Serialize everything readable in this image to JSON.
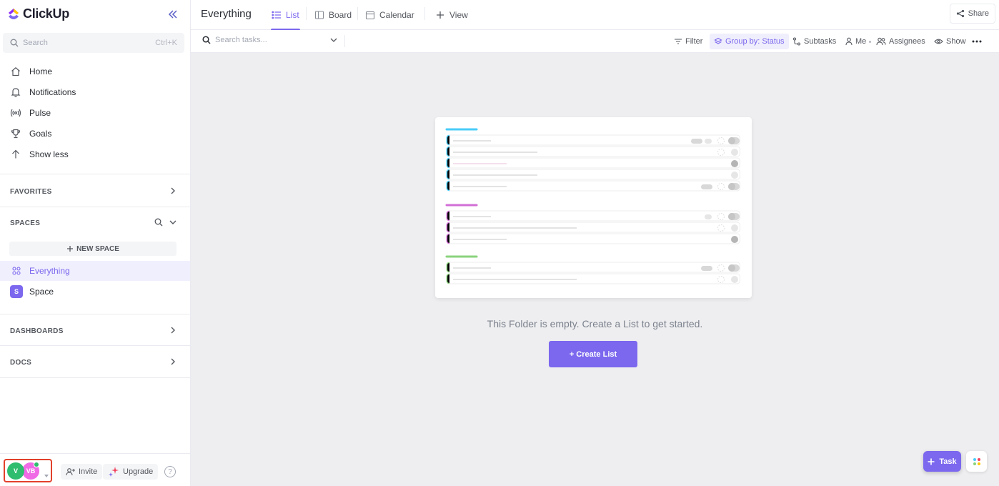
{
  "brand": {
    "name": "ClickUp"
  },
  "sidebar": {
    "search": {
      "placeholder": "Search",
      "shortcut": "Ctrl+K"
    },
    "nav": [
      {
        "label": "Home",
        "icon": "home-icon"
      },
      {
        "label": "Notifications",
        "icon": "bell-icon"
      },
      {
        "label": "Pulse",
        "icon": "pulse-icon"
      },
      {
        "label": "Goals",
        "icon": "trophy-icon"
      },
      {
        "label": "Show less",
        "icon": "arrow-up-icon"
      }
    ],
    "favorites_label": "FAVORITES",
    "spaces_label": "SPACES",
    "new_space_label": "NEW SPACE",
    "spaces": [
      {
        "label": "Everything",
        "active": true
      },
      {
        "label": "Space",
        "badge": "S"
      }
    ],
    "dashboards_label": "DASHBOARDS",
    "docs_label": "DOCS",
    "footer": {
      "avatar_1": "V",
      "avatar_2": "VB",
      "invite_label": "Invite",
      "upgrade_label": "Upgrade",
      "help_label": "?"
    }
  },
  "header": {
    "title": "Everything",
    "tabs": [
      {
        "label": "List",
        "active": true
      },
      {
        "label": "Board"
      },
      {
        "label": "Calendar"
      },
      {
        "label": "View"
      }
    ],
    "share_label": "Share"
  },
  "toolbar": {
    "search_placeholder": "Search tasks...",
    "filter_label": "Filter",
    "group_label": "Group by: Status",
    "subtasks_label": "Subtasks",
    "me_label": "Me",
    "assignees_label": "Assignees",
    "show_label": "Show"
  },
  "main": {
    "empty_text": "This Folder is empty. Create a List to get started.",
    "create_button": "+ Create List",
    "task_button": "Task"
  },
  "colors": {
    "accent": "#7b68ee",
    "group_blue": "#49ccf9",
    "group_pink": "#d36fd6",
    "group_green": "#8bd37d",
    "avatar_green": "#2ebd6f",
    "avatar_pink": "#f06ae6"
  }
}
